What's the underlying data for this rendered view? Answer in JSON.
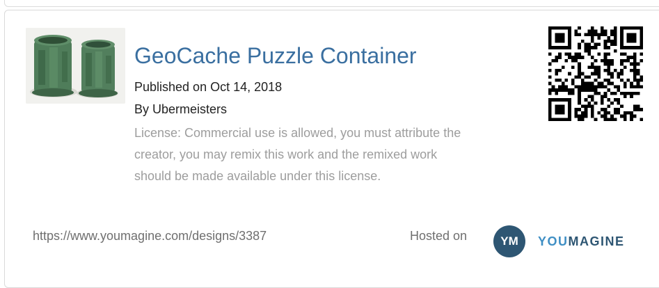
{
  "design": {
    "title": "GeoCache Puzzle Container",
    "published": "Published on Oct 14, 2018",
    "author": "By Ubermeisters",
    "license": "License: Commercial use is allowed, you must attribute the creator, you may remix this work and the remixed work should be made available under this license.",
    "url": "https://www.youmagine.com/designs/3387"
  },
  "footer": {
    "hosted_label": "Hosted on",
    "badge_text": "YM",
    "brand_you": "YOU",
    "brand_magine": "MAGINE"
  },
  "colors": {
    "title": "#3a6fa0",
    "brand_dark": "#2e5673",
    "brand_light": "#3f8fc4",
    "license_text": "#9d9d9d"
  },
  "icons": {
    "thumbnail": "design-thumbnail-image",
    "qr": "qr-code-icon",
    "logo": "youmagine-logo"
  }
}
